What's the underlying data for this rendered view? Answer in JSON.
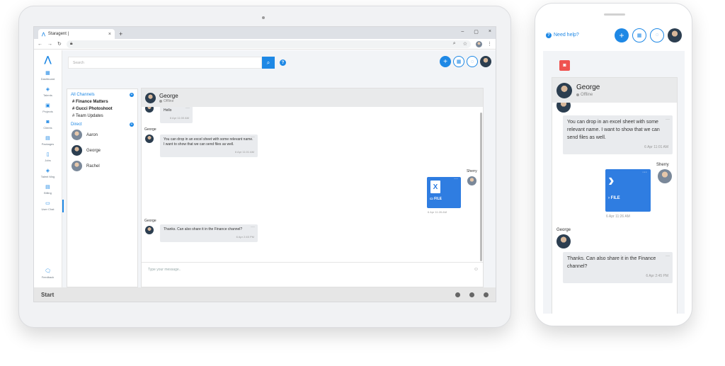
{
  "browser": {
    "tab_title": "Staragent |",
    "tab_close": "×",
    "new_tab": "+",
    "win_min": "–",
    "win_max": "▢",
    "win_close": "×"
  },
  "app": {
    "search_placeholder": "Search",
    "help": "?",
    "nav": [
      {
        "icon": "dashboard-icon",
        "glyph": "▦",
        "label": "Dashboard"
      },
      {
        "icon": "talents-icon",
        "glyph": "◈",
        "label": "Talents"
      },
      {
        "icon": "projects-icon",
        "glyph": "▣",
        "label": "Projects"
      },
      {
        "icon": "clients-icon",
        "glyph": "◙",
        "label": "Clients"
      },
      {
        "icon": "packages-icon",
        "glyph": "▤",
        "label": "Packages"
      },
      {
        "icon": "jobs-icon",
        "glyph": "▯",
        "label": "Jobs"
      },
      {
        "icon": "talent-mgt-icon",
        "glyph": "◈",
        "label": "Talent Mng"
      },
      {
        "icon": "billing-icon",
        "glyph": "▤",
        "label": "Billing"
      },
      {
        "icon": "user-chat-icon",
        "glyph": "▭",
        "label": "User Chat"
      }
    ],
    "feedback": "Feedback",
    "channels": {
      "all_label": "All Channels",
      "items": [
        "Finance Matters",
        "Gucci Photoshoot",
        "Team Updates"
      ],
      "direct_label": "Direct",
      "direct": [
        "Aaron",
        "George",
        "Rachel"
      ]
    },
    "chat": {
      "name": "George",
      "status": "Offline",
      "messages": [
        {
          "text": "Hello",
          "time": "6 Apr 11:00 AM"
        },
        {
          "sender": "George",
          "text": "You can drop in an excel sheet with some relevant name. I want to show that we can send files as well.",
          "time": "6 Apr 11:01 AM"
        },
        {
          "sender": "Sherry",
          "file_label": "FILE",
          "time": "6 Apr 11:26 AM"
        },
        {
          "sender": "George",
          "text": "Thanks. Can also share it in the Finance channel?",
          "time": "6 Apr 2:45 PM"
        }
      ],
      "input_placeholder": "Type your message.."
    },
    "taskbar": "Start"
  },
  "phone": {
    "need_help": "Need help?"
  },
  "colors": {
    "accent": "#1e88e5",
    "file": "#2f7de1",
    "chat_button": "#ef5350"
  }
}
